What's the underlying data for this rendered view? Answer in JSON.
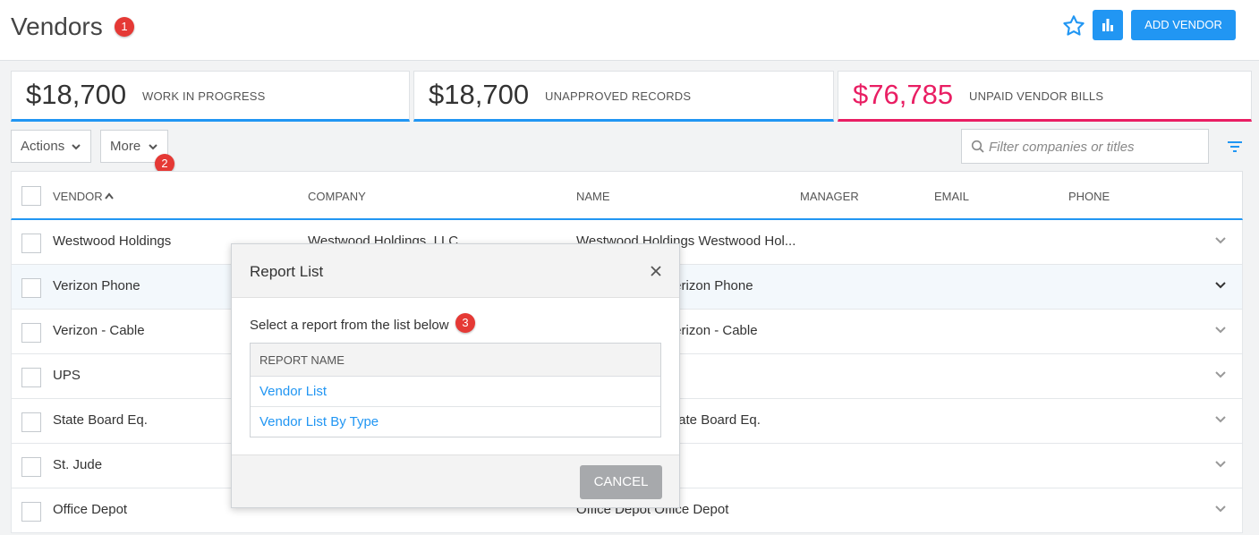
{
  "header": {
    "title": "Vendors",
    "title_badge": "1",
    "add_vendor_label": "ADD VENDOR",
    "accent_color": "#2196f3"
  },
  "stats": [
    {
      "amount": "$18,700",
      "label": "WORK IN PROGRESS",
      "color": "#2196f3"
    },
    {
      "amount": "$18,700",
      "label": "UNAPPROVED RECORDS",
      "color": "#2196f3"
    },
    {
      "amount": "$76,785",
      "label": "UNPAID VENDOR BILLS",
      "color": "#e91e63"
    }
  ],
  "toolbar": {
    "actions_label": "Actions",
    "more_label": "More",
    "more_badge": "2",
    "filter_placeholder": "Filter companies or titles"
  },
  "table": {
    "columns": [
      "VENDOR",
      "COMPANY",
      "NAME",
      "MANAGER",
      "EMAIL",
      "PHONE"
    ],
    "rows": [
      {
        "vendor": "Westwood Holdings",
        "company": "Westwood Holdings, LLC",
        "name": "Westwood Holdings Westwood Hol..."
      },
      {
        "vendor": "Verizon Phone",
        "company": "",
        "name": "Verizon Phone"
      },
      {
        "vendor": "Verizon - Cable",
        "company": "",
        "name": "Verizon - Cable"
      },
      {
        "vendor": "UPS",
        "company": "",
        "name": ""
      },
      {
        "vendor": "State Board Eq.",
        "company": "",
        "name": "State Board Eq."
      },
      {
        "vendor": "St. Jude",
        "company": "",
        "name": ""
      },
      {
        "vendor": "Office Depot",
        "company": "",
        "name": "Office Depot Office Depot"
      }
    ]
  },
  "modal": {
    "title": "Report List",
    "instruction": "Select a report from the list below",
    "instruction_badge": "3",
    "column_header": "REPORT NAME",
    "reports": [
      "Vendor List",
      "Vendor List By Type"
    ],
    "cancel_label": "CANCEL"
  }
}
